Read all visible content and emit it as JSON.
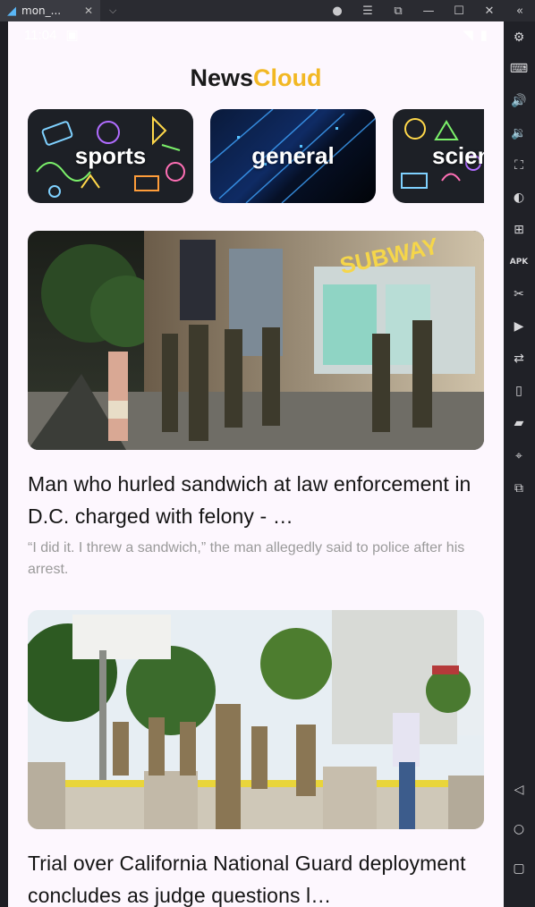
{
  "window": {
    "tab_title": "mon_...",
    "tab_close": "✕",
    "tab_dropdown": "⌵"
  },
  "app": {
    "title_part1": "News",
    "title_part2": "Cloud",
    "accent_color": "#f2b824"
  },
  "statusbar": {
    "time": "11:04"
  },
  "categories": [
    {
      "label": "sports"
    },
    {
      "label": "general"
    },
    {
      "label": "science"
    }
  ],
  "articles": [
    {
      "headline": "Man who hurled sandwich at law enforcement in D.C. charged with felony - …",
      "description": "“I did it. I threw a sandwich,” the man allegedly said to police after his arrest.",
      "image": "street-night-officers-subway-photo"
    },
    {
      "headline": "Trial over California National Guard deployment concludes as judge questions l…",
      "description": "",
      "image": "national-guard-palm-trees-photo"
    }
  ],
  "toolbar_icons": [
    "settings-icon",
    "keyboard-icon",
    "volume-up-icon",
    "volume-down-icon",
    "screenshot-icon",
    "shake-icon",
    "install-icon",
    "apk-icon",
    "cut-icon",
    "record-icon",
    "sync-icon",
    "rotate-icon",
    "folder-icon",
    "location-icon",
    "multi-window-icon",
    "back-icon",
    "home-icon",
    "recents-icon"
  ]
}
